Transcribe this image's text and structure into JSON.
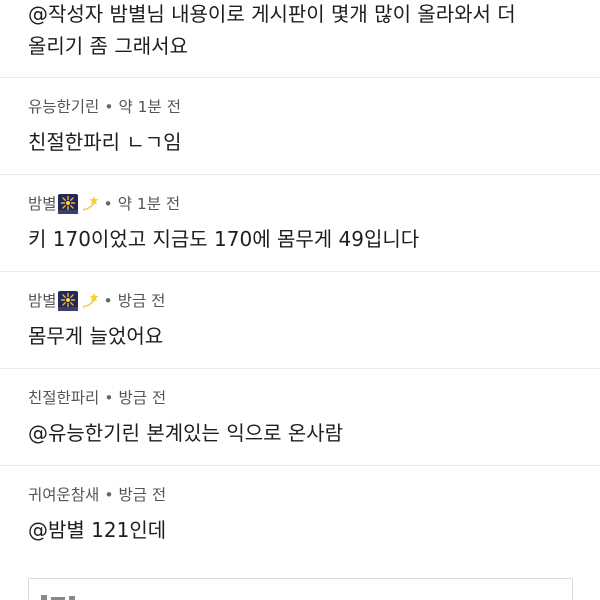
{
  "comments": [
    {
      "author": "",
      "time": "",
      "text_line1": "@작성자 밤별님 내용이로 게시판이 몇개 많이 올라와서 더",
      "text_line2": "올리기 좀 그래서요"
    },
    {
      "author": "유능한기린",
      "separator": "•",
      "time": "약 1분 전",
      "text": "친절한파리 ㄴㄱ임"
    },
    {
      "author": "밤별",
      "emoji_icons": [
        "fireworks-icon",
        "dizzy-star-icon"
      ],
      "separator": "•",
      "time": "약 1분 전",
      "text": "키 170이었고 지금도 170에 몸무게 49입니다"
    },
    {
      "author": "밤별",
      "emoji_icons": [
        "fireworks-icon",
        "dizzy-star-icon"
      ],
      "separator": "•",
      "time": "방금 전",
      "text": "몸무게 늘었어요"
    },
    {
      "author": "친절한파리",
      "separator": "•",
      "time": "방금 전",
      "text": "@유능한기린 본계있는 익으로 온사람"
    },
    {
      "author": "귀여운참새",
      "separator": "•",
      "time": "방금 전",
      "text": "@밤별 121인데"
    }
  ],
  "colors": {
    "divider": "#ececec",
    "meta_text": "#555555",
    "body_text": "#1e1e1e"
  }
}
